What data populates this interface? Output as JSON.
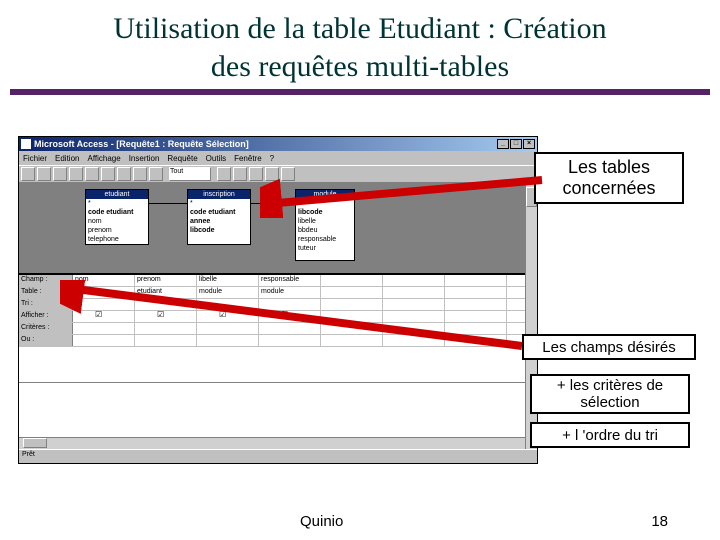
{
  "slide": {
    "title_line1": "Utilisation de la table Etudiant : Création",
    "title_line2": "des requêtes multi-tables"
  },
  "window": {
    "title": "Microsoft Access - [Requête1 : Requête Sélection]",
    "menus": [
      "Fichier",
      "Edition",
      "Affichage",
      "Insertion",
      "Requête",
      "Outils",
      "Fenêtre",
      "?"
    ],
    "toolbar_select_value": "Tout"
  },
  "tables": {
    "etudiant": {
      "name": "etudiant",
      "fields": [
        "*",
        "code etudiant",
        "nom",
        "prenom",
        "telephone"
      ]
    },
    "inscription": {
      "name": "inscription",
      "fields": [
        "*",
        "code etudiant",
        "annee",
        "libcode"
      ]
    },
    "module": {
      "name": "module",
      "fields": [
        "*",
        "libcode",
        "libelle",
        "bbdeu",
        "responsable",
        "tuteur"
      ]
    }
  },
  "grid": {
    "row_labels": [
      "Champ :",
      "Table :",
      "Tri :",
      "Afficher :",
      "Critères :",
      "Ou :"
    ],
    "champ": [
      "nom",
      "prenom",
      "libelle",
      "responsable"
    ],
    "table": [
      "etudiant",
      "etudiant",
      "module",
      "module"
    ]
  },
  "callouts": {
    "c1": "Les tables concernées",
    "c2": "Les champs désirés",
    "c3": "+ les critères de sélection",
    "c4": "+ l 'ordre du tri"
  },
  "footer": {
    "author": "Quinio",
    "page": "18"
  },
  "status": "Prêt"
}
